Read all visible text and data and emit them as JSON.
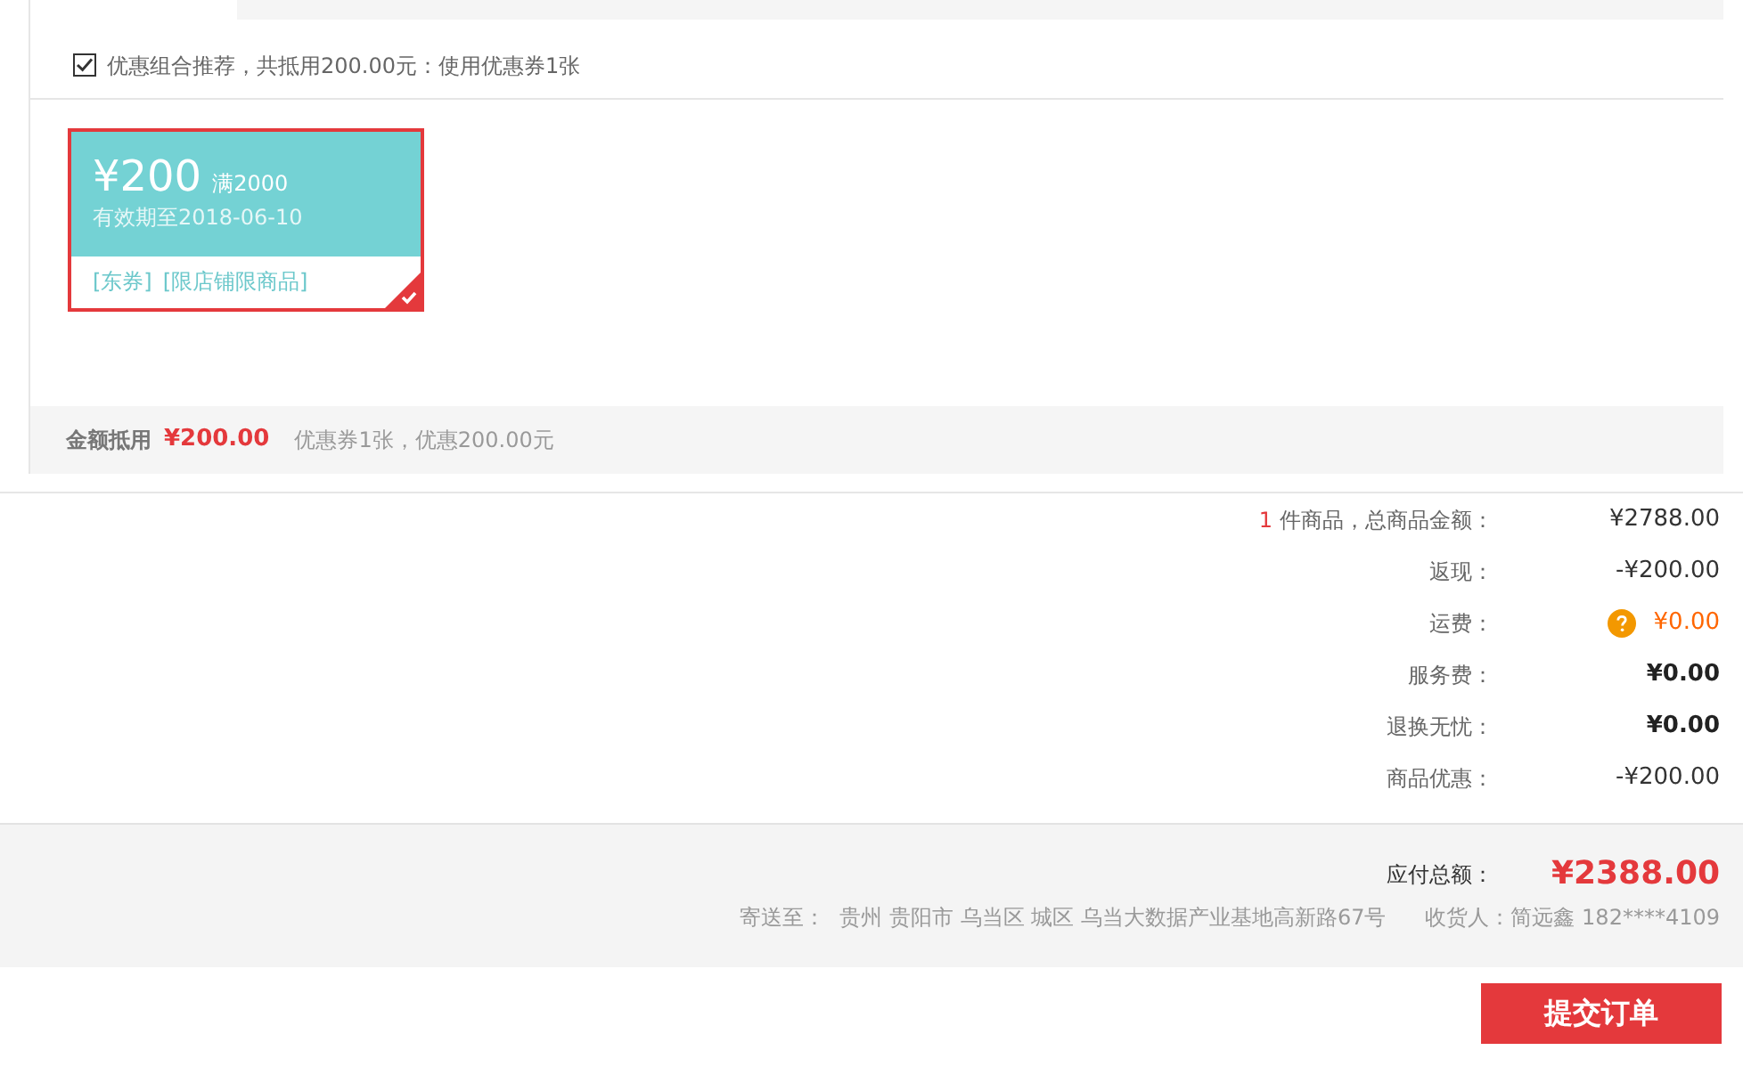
{
  "coupon_panel": {
    "recommend": {
      "checked": true,
      "text": "优惠组合推荐，共抵用200.00元：使用优惠券1张"
    },
    "coupons": [
      {
        "amount": "¥200",
        "condition": "满2000",
        "validity": "有效期至2018-06-10",
        "tags": [
          "[东券]",
          "[限店铺限商品]"
        ],
        "selected": true
      }
    ],
    "summary": {
      "label": "金额抵用",
      "amount": "¥200.00",
      "detail": "优惠券1张，优惠200.00元"
    }
  },
  "order_summary": {
    "rows": [
      {
        "kind": "count",
        "count": "1",
        "label": "件商品，总商品金额：",
        "value": "¥2788.00"
      },
      {
        "kind": "plain",
        "label": "返现：",
        "value": "-¥200.00"
      },
      {
        "kind": "shipping",
        "label": "运费：",
        "value": "¥0.00"
      },
      {
        "kind": "strong",
        "label": "服务费：",
        "value": "¥0.00"
      },
      {
        "kind": "strong",
        "label": "退换无忧：",
        "value": "¥0.00"
      },
      {
        "kind": "plain",
        "label": "商品优惠：",
        "value": "-¥200.00"
      }
    ]
  },
  "payment": {
    "total_label": "应付总额：",
    "total": "¥2388.00",
    "address_label": "寄送至：",
    "address": "贵州 贵阳市 乌当区 城区 乌当大数据产业基地高新路67号",
    "receiver": "收货人：简远鑫 182****4109"
  },
  "submit_button": "提交订单"
}
